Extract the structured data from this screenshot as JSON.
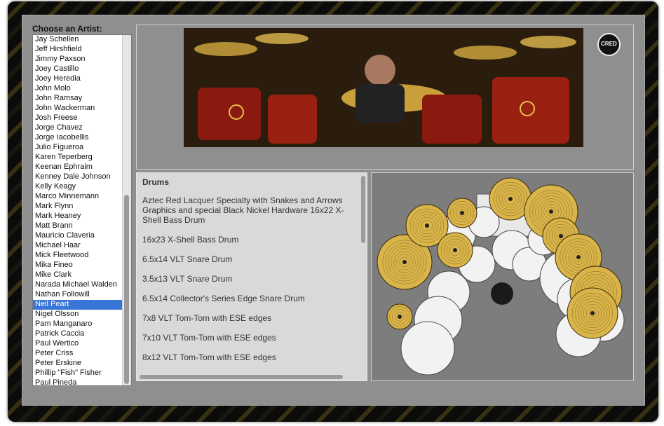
{
  "artist_panel": {
    "heading": "Choose an Artist:",
    "selected": "Neil Peart",
    "artists": [
      "Jay Schellen",
      "Jeff Hirshfield",
      "Jimmy Paxson",
      "Joey Castillo",
      "Joey Heredia",
      "John Molo",
      "John Ramsay",
      "John Wackerman",
      "Josh Freese",
      "Jorge Chavez",
      "Jorge Iacobellis",
      "Julio Figueroa",
      "Karen Teperberg",
      "Keenan Ephraim",
      "Kenney Dale Johnson",
      "Kelly Keagy",
      "Marco Minnemann",
      "Mark Flynn",
      "Mark Heaney",
      "Matt Brann",
      "Mauricio Claveria",
      "Michael Haar",
      "Mick Fleetwood",
      "Mika Fineo",
      "Mike Clark",
      "Narada Michael Walden",
      "Nathan Followill",
      "Neil Peart",
      "Nigel Olsson",
      "Pam Manganaro",
      "Patrick Caccia",
      "Paul Wertico",
      "Peter Criss",
      "Peter Erskine",
      "Phillip \"Fish\" Fisher",
      "Paul Pineda"
    ]
  },
  "photo": {
    "badge_text": "CRED",
    "alt": "drummer-photo"
  },
  "info": {
    "title": "Drums",
    "items": [
      "Aztec Red Lacquer Specialty with Snakes and Arrows Graphics and special Black Nickel Hardware 16x22 X-Shell Bass Drum",
      "16x23 X-Shell Bass Drum",
      "6.5x14 VLT Snare Drum",
      "3.5x13 VLT Snare Drum",
      "6.5x14 Collector's Series Edge Snare Drum",
      "7x8 VLT Tom-Tom with ESE edges",
      "7x10 VLT Tom-Tom with ESE edges",
      "8x12 VLT Tom-Tom with ESE edges"
    ]
  },
  "colors": {
    "selection": "#3875d7",
    "cymbal": "#d8b44a",
    "drum": "#f2f2f2",
    "panel": "#8f8f8f"
  }
}
